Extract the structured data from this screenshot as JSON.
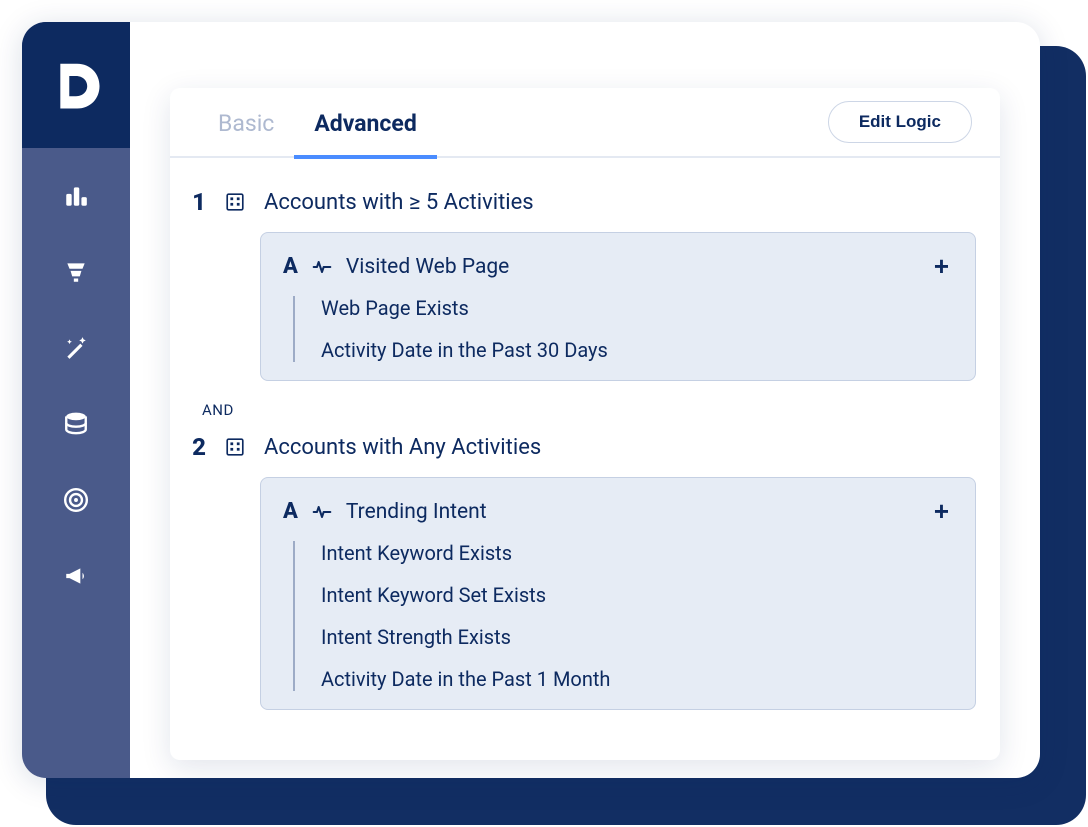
{
  "tabs": {
    "basic": "Basic",
    "advanced": "Advanced"
  },
  "buttons": {
    "edit_logic": "Edit Logic",
    "plus": "+"
  },
  "operator": "AND",
  "rules": [
    {
      "num": "1",
      "title": "Accounts with  ≥  5 Activities",
      "sub": {
        "letter": "A",
        "title": "Visited Web Page",
        "conditions": [
          "Web Page Exists",
          "Activity Date in the Past 30 Days"
        ]
      }
    },
    {
      "num": "2",
      "title": "Accounts with Any Activities",
      "sub": {
        "letter": "A",
        "title": "Trending Intent",
        "conditions": [
          "Intent Keyword Exists",
          "Intent Keyword Set Exists",
          "Intent Strength Exists",
          "Activity Date in the Past 1 Month"
        ]
      }
    }
  ]
}
